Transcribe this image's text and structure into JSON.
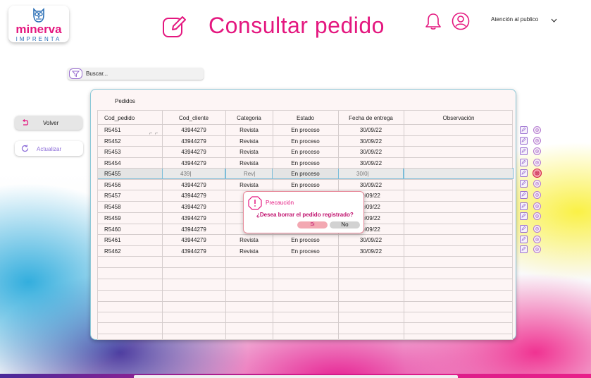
{
  "brand": {
    "name": "minerva",
    "sub": "IMPRENTA"
  },
  "header": {
    "title": "Consultar pedido",
    "user": "Atención al publico"
  },
  "search": {
    "placeholder": "Buscar..."
  },
  "nav": {
    "back": "Volver",
    "refresh": "Actualizar"
  },
  "panel": {
    "label": "Pedidos"
  },
  "table": {
    "columns": [
      "Cod_pedido",
      "Cod_cliente",
      "Categoria",
      "Estado",
      "Fecha de entrega",
      "Observación"
    ],
    "rows": [
      [
        "R5451",
        "43944279",
        "Revista",
        "En proceso",
        "30/09/22",
        ""
      ],
      [
        "R5452",
        "43944279",
        "Revista",
        "En proceso",
        "30/09/22",
        ""
      ],
      [
        "R5453",
        "43944279",
        "Revista",
        "En proceso",
        "30/09/22",
        ""
      ],
      [
        "R5454",
        "43944279",
        "Revista",
        "En proceso",
        "30/09/22",
        ""
      ],
      [
        "R5455",
        "439|",
        "Rev|",
        "En proceso",
        "30/0|",
        ""
      ],
      [
        "R5456",
        "43944279",
        "Revista",
        "En proceso",
        "30/09/22",
        ""
      ],
      [
        "R5457",
        "43944279",
        "Re",
        "",
        "0/09/22",
        ""
      ],
      [
        "R5458",
        "43944279",
        "Re",
        "",
        "0/09/22",
        ""
      ],
      [
        "R5459",
        "43944279",
        "Re",
        "",
        "0/09/22",
        ""
      ],
      [
        "R5460",
        "43944279",
        "Re",
        "",
        "0/09/22",
        ""
      ],
      [
        "R5461",
        "43944279",
        "Revista",
        "En proceso",
        "30/09/22",
        ""
      ],
      [
        "R5462",
        "43944279",
        "Revista",
        "En proceso",
        "30/09/22",
        ""
      ]
    ],
    "selected_row": 4
  },
  "dialog": {
    "title": "Precaución",
    "message": "¿Desea borrar el pedido registrado?",
    "yes": "Si",
    "no": "No"
  },
  "colors": {
    "brand": "#e4177f",
    "accent": "#8a6ad8"
  },
  "icons": [
    "edit-icon",
    "bell-icon",
    "user-icon",
    "filter-icon",
    "back-arrow-icon",
    "refresh-icon",
    "delete-icon",
    "warning-icon"
  ]
}
